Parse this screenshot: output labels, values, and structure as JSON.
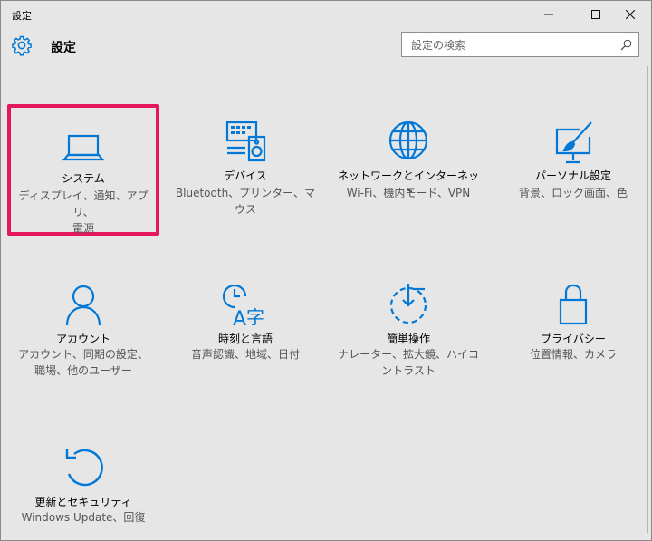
{
  "window": {
    "title": "設定",
    "minimize_icon": "minimize-icon",
    "maximize_icon": "maximize-icon",
    "close_icon": "close-icon"
  },
  "header": {
    "title": "設定",
    "icon": "gear-icon"
  },
  "search": {
    "placeholder": "設定の検索",
    "value": ""
  },
  "accent_color": "#0078d7",
  "selection_color": "#e5175c",
  "tiles": [
    {
      "title": "システム",
      "desc_line1": "ディスプレイ、通知、アプリ、",
      "desc_line2": "電源",
      "icon": "laptop-icon"
    },
    {
      "title": "デバイス",
      "desc_line1": "Bluetooth、プリンター、マ",
      "desc_line2": "ウス",
      "icon": "devices-icon"
    },
    {
      "title": "ネットワークとインターネット",
      "desc_line1": "Wi-Fi、機内モード、VPN",
      "desc_line2": "",
      "icon": "globe-icon"
    },
    {
      "title": "パーソナル設定",
      "desc_line1": "背景、ロック画面、色",
      "desc_line2": "",
      "icon": "personalization-icon"
    },
    {
      "title": "アカウント",
      "desc_line1": "アカウント、同期の設定、",
      "desc_line2": "職場、他のユーザー",
      "icon": "person-icon"
    },
    {
      "title": "時刻と言語",
      "desc_line1": "音声認識、地域、日付",
      "desc_line2": "",
      "icon": "time-language-icon"
    },
    {
      "title": "簡単操作",
      "desc_line1": "ナレーター、拡大鏡、ハイコ",
      "desc_line2": "ントラスト",
      "icon": "ease-of-access-icon"
    },
    {
      "title": "プライバシー",
      "desc_line1": "位置情報、カメラ",
      "desc_line2": "",
      "icon": "lock-icon"
    },
    {
      "title": "更新とセキュリティ",
      "desc_line1": "Windows Update、回復",
      "desc_line2": "",
      "icon": "update-icon"
    }
  ]
}
